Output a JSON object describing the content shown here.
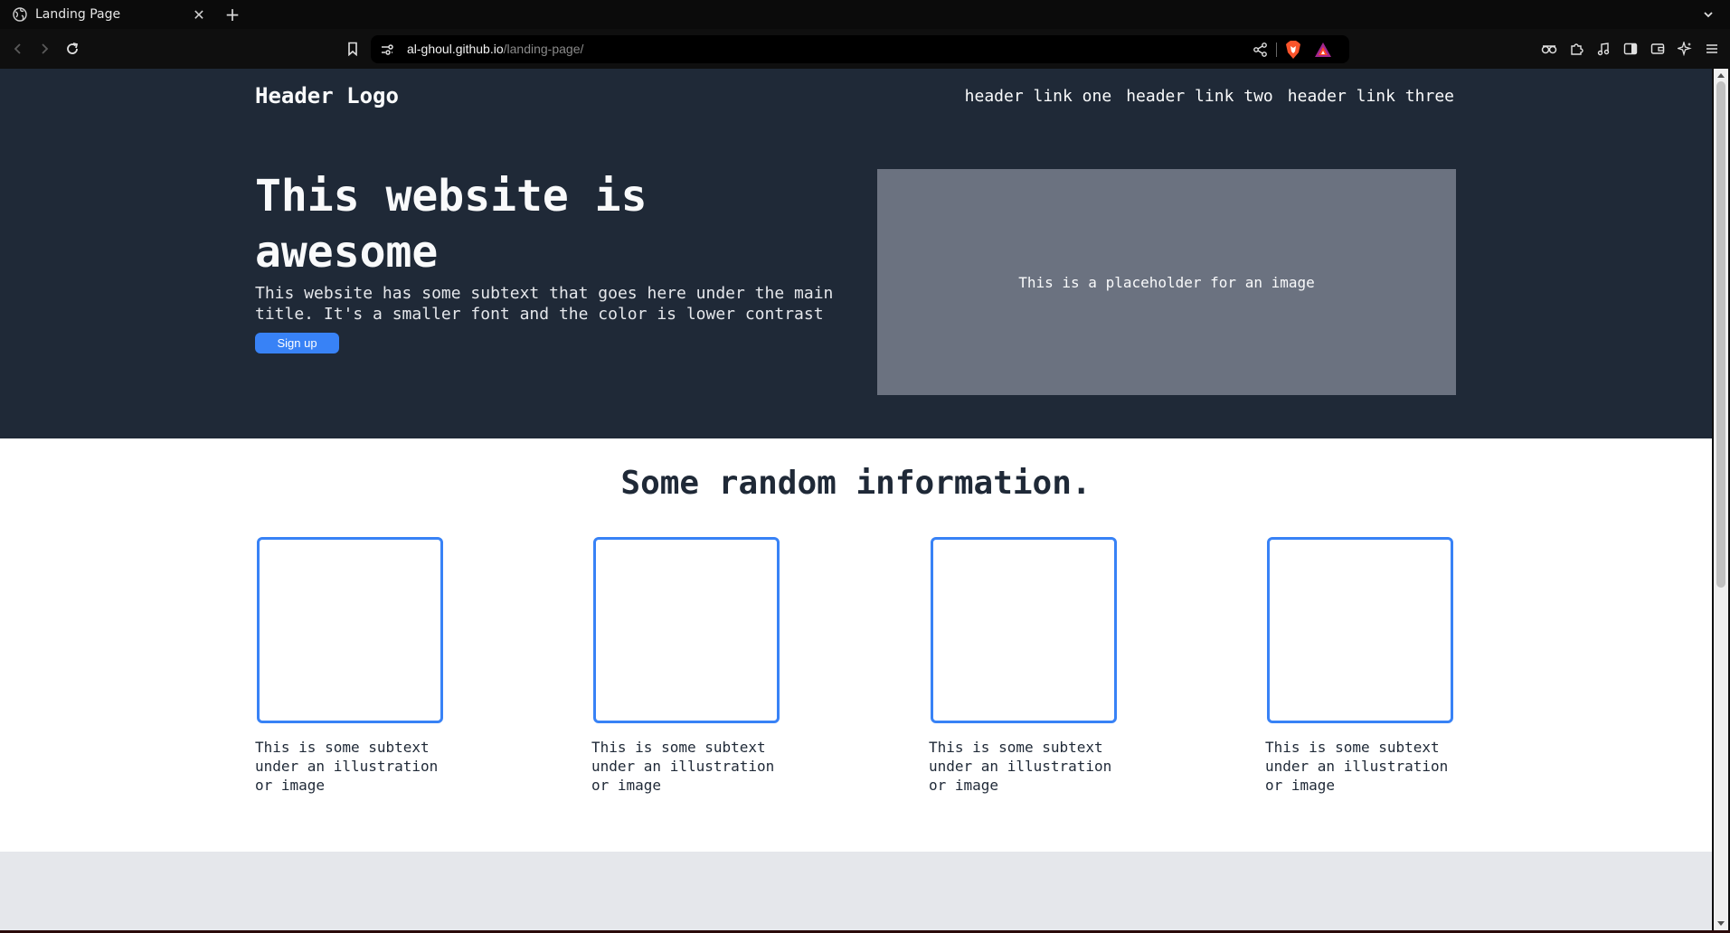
{
  "browser": {
    "tab_title": "Landing Page",
    "close_glyph": "✕",
    "newtab_glyph": "+",
    "url_host": "al-ghoul.github.io",
    "url_path": "/landing-page/",
    "icons": [
      "globe-icon",
      "back-icon",
      "forward-icon",
      "reload-icon",
      "bookmark-icon",
      "site-info-icon",
      "share-icon",
      "brave-shields-icon",
      "brave-rewards-icon",
      "leo-icon",
      "extensions-icon",
      "media-icon",
      "sidebar-icon",
      "wallet-icon",
      "ai-icon",
      "menu-icon"
    ]
  },
  "page": {
    "header": {
      "logo": "Header Logo",
      "links": [
        "header link one",
        "header link two",
        "header link three"
      ]
    },
    "hero": {
      "title": "This website is awesome",
      "subtitle": "This website has some subtext that goes here under the main title. It's a smaller font and the color is lower contrast",
      "button": "Sign up",
      "image_placeholder": "This is a placeholder for an image"
    },
    "info": {
      "title": "Some random information.",
      "cards": [
        {
          "caption": "This is some subtext under an illustration or image"
        },
        {
          "caption": "This is some subtext under an illustration or image"
        },
        {
          "caption": "This is some subtext under an illustration or image"
        },
        {
          "caption": "This is some subtext under an illustration or image"
        }
      ]
    },
    "colors": {
      "hero_bg": "#1f2937",
      "accent": "#3882f6",
      "placeholder_bg": "#6b7280",
      "section_gray": "#e5e7eb"
    }
  }
}
